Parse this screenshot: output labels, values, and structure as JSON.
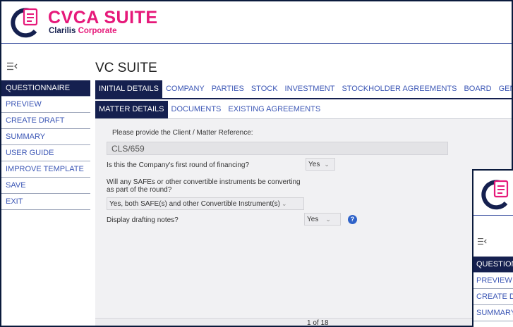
{
  "colors": {
    "brand_pink": "#e6197a",
    "navy": "#15204f",
    "link_blue": "#3b56b5",
    "help_blue": "#2f63c9"
  },
  "brand": {
    "title_part1": "CVCA",
    "title_part2": " SUITE",
    "subtitle_part1": "Clarilis ",
    "subtitle_part2": "Corporate",
    "logo_icon": "document-in-circle-logo"
  },
  "page_title": "VC SUITE",
  "sidebar": {
    "items": [
      {
        "label": "QUESTIONNAIRE",
        "active": true
      },
      {
        "label": "PREVIEW"
      },
      {
        "label": "CREATE DRAFT"
      },
      {
        "label": "SUMMARY"
      },
      {
        "label": "USER GUIDE"
      },
      {
        "label": "IMPROVE TEMPLATE"
      },
      {
        "label": "SAVE"
      },
      {
        "label": "EXIT"
      }
    ]
  },
  "tabs_primary": [
    "INITIAL DETAILS",
    "COMPANY",
    "PARTIES",
    "STOCK",
    "INVESTMENT",
    "STOCKHOLDER AGREEMENTS",
    "BOARD",
    "GENERAL"
  ],
  "tabs_secondary": [
    "MATTER DETAILS",
    "DOCUMENTS",
    "EXISTING AGREEMENTS"
  ],
  "form": {
    "ref_label": "Please provide the Client / Matter Reference:",
    "ref_value": "CLS/659",
    "q1_label": "Is this the Company's first round of financing?",
    "q1_value": "Yes",
    "q2_label_line1": "Will any SAFEs or other convertible instruments be converting",
    "q2_label_line2": "as part of the round?",
    "q2_value": "Yes, both SAFE(s) and other Convertible Instrument(s)",
    "q3_label": "Display drafting notes?",
    "q3_value": "Yes",
    "help_glyph": "?"
  },
  "pager": "1 of 18",
  "second_window": {
    "items": [
      "QUESTIONNAIRE",
      "PREVIEW",
      "CREATE DRAFT",
      "SUMMARY"
    ]
  }
}
